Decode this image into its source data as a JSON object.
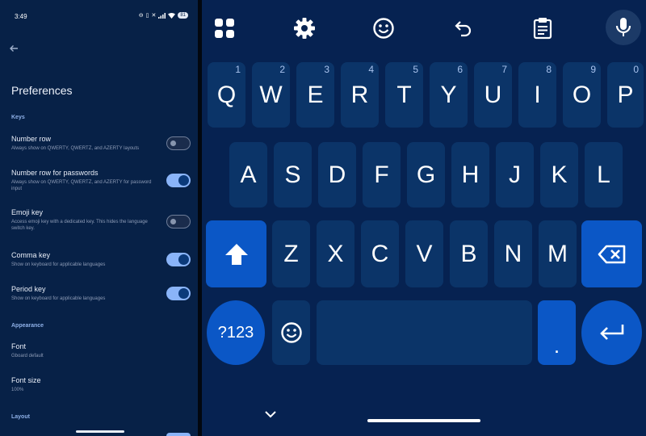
{
  "status_bar": {
    "time": "3:49",
    "icons": [
      "do-not-disturb-icon",
      "vibrate-icon",
      "mute-icon",
      "signal-icon",
      "wifi-icon"
    ],
    "battery": "81"
  },
  "settings": {
    "title": "Preferences",
    "sections": {
      "keys": "Keys",
      "appearance": "Appearance",
      "layout": "Layout"
    },
    "items": {
      "number_row": {
        "title": "Number row",
        "subtitle": "Always show on QWERTY, QWERTZ, and AZERTY layouts",
        "enabled": false
      },
      "number_row_passwords": {
        "title": "Number row for passwords",
        "subtitle": "Always show on QWERTY, QWERTZ, and AZERTY for password input",
        "enabled": true
      },
      "emoji_key": {
        "title": "Emoji key",
        "subtitle": "Access emoji key with a dedicated key. This hides the language switch key.",
        "enabled": false
      },
      "comma_key": {
        "title": "Comma key",
        "subtitle": "Show on keyboard for applicable languages",
        "enabled": true
      },
      "period_key": {
        "title": "Period key",
        "subtitle": "Show on keyboard for applicable languages",
        "enabled": true
      },
      "font": {
        "title": "Font",
        "subtitle": "Gboard default"
      },
      "font_size": {
        "title": "Font size",
        "subtitle": "100%"
      }
    }
  },
  "keyboard": {
    "colors": {
      "background": "#062251",
      "key": "#0b3468",
      "accent_key": "#0b57c6",
      "key_text": "#ffffff",
      "hint_text": "#a9c3ee"
    },
    "toolbar": [
      "apps-grid-icon",
      "settings-gear-icon",
      "emoji-icon",
      "undo-icon",
      "clipboard-icon",
      "microphone-icon"
    ],
    "row1": [
      {
        "label": "Q",
        "hint": "1"
      },
      {
        "label": "W",
        "hint": "2"
      },
      {
        "label": "E",
        "hint": "3"
      },
      {
        "label": "R",
        "hint": "4"
      },
      {
        "label": "T",
        "hint": "5"
      },
      {
        "label": "Y",
        "hint": "6"
      },
      {
        "label": "U",
        "hint": "7"
      },
      {
        "label": "I",
        "hint": "8"
      },
      {
        "label": "O",
        "hint": "9"
      },
      {
        "label": "P",
        "hint": "0"
      }
    ],
    "row2": [
      "A",
      "S",
      "D",
      "F",
      "G",
      "H",
      "J",
      "K",
      "L"
    ],
    "row3": [
      "Z",
      "X",
      "C",
      "V",
      "B",
      "N",
      "M"
    ],
    "symbols_label": "?123",
    "period_label": "."
  }
}
